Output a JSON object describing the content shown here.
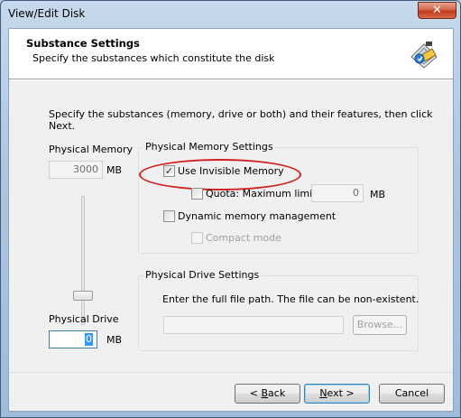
{
  "window": {
    "title": "View/Edit Disk",
    "close_glyph": "✕"
  },
  "header": {
    "title": "Substance Settings",
    "subtitle": "Specify the substances which constitute the disk",
    "icon": "disk-settings-icon"
  },
  "intro_text": "Specify the substances (memory, drive or both) and their features, then click Next.",
  "physical_memory": {
    "label": "Physical Memory",
    "value": "3000",
    "unit": "MB"
  },
  "physical_memory_settings": {
    "title": "Physical Memory Settings",
    "use_invisible_memory": {
      "label": "Use Invisible Memory",
      "checked": true
    },
    "quota": {
      "label": "Quota: Maximum limit",
      "checked": false,
      "value": "0",
      "unit": "MB"
    },
    "dynamic": {
      "label": "Dynamic memory management",
      "checked": false
    },
    "compact": {
      "label": "Compact mode",
      "checked": false,
      "enabled": false
    }
  },
  "physical_drive": {
    "label": "Physical Drive",
    "value": "0",
    "unit": "MB"
  },
  "physical_drive_settings": {
    "title": "Physical Drive Settings",
    "instruction": "Enter the full file path. The file can be non-existent.",
    "path_value": "",
    "browse_label": "Browse..."
  },
  "buttons": {
    "back_prefix": "< ",
    "back_key": "B",
    "back_rest": "ack",
    "next_key": "N",
    "next_rest": "ext >",
    "cancel": "Cancel"
  },
  "colors": {
    "annotation": "#d21f1f",
    "accent": "#3c7fb1"
  }
}
